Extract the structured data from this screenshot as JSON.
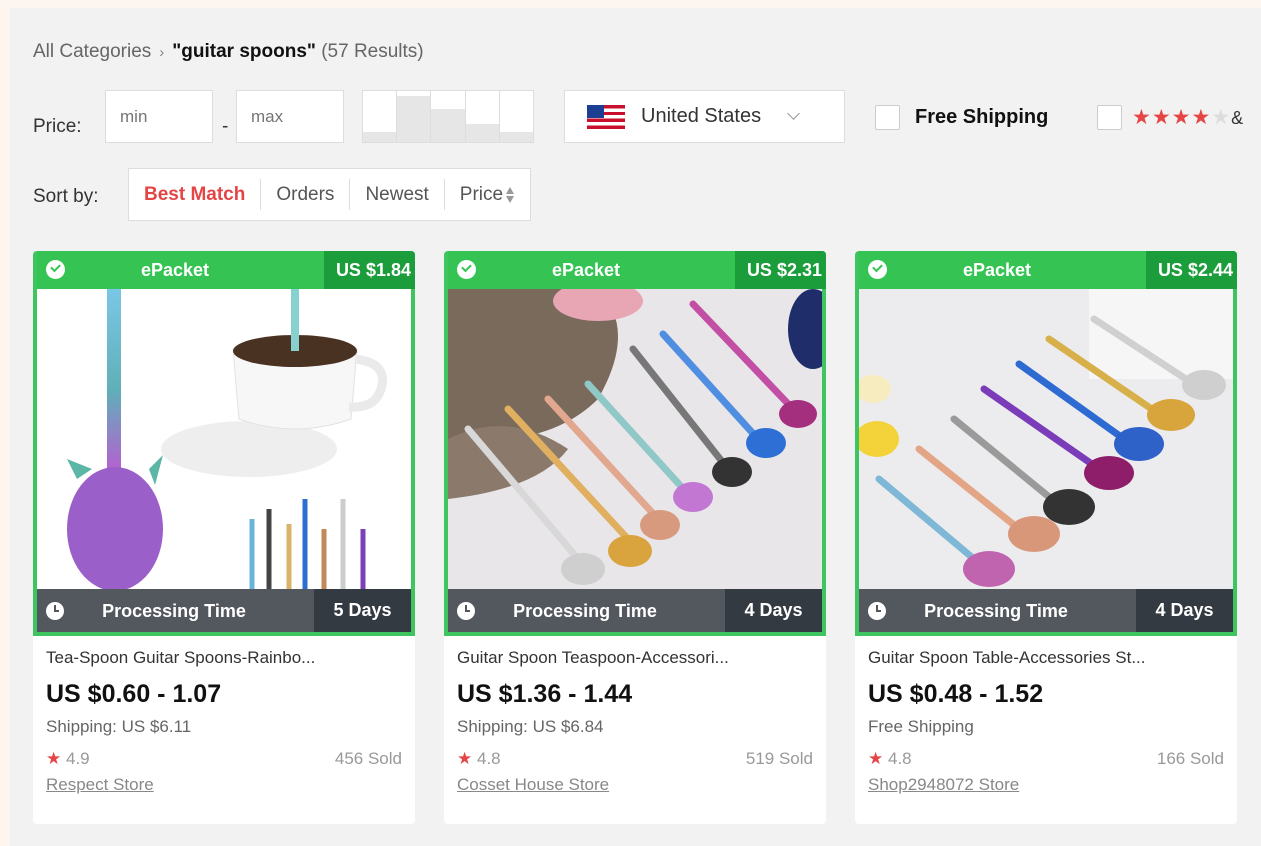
{
  "breadcrumb": {
    "root": "All Categories",
    "separator": "›",
    "query": "\"guitar spoons\"",
    "count": "(57 Results)"
  },
  "filters": {
    "price_label": "Price:",
    "min_placeholder": "min",
    "max_placeholder": "max",
    "dash": "-",
    "histogram_levels": [
      0.2,
      0.9,
      0.65,
      0.35,
      0.2
    ],
    "country": "United States",
    "free_shipping_label": "Free Shipping",
    "rating_stars": "★★★★",
    "rating_star_empty": "★",
    "rating_more": "&"
  },
  "sort": {
    "label": "Sort by:",
    "options": [
      "Best Match",
      "Orders",
      "Newest",
      "Price"
    ],
    "active": "Best Match"
  },
  "colors": {
    "accent": "#e64545",
    "epacket_green": "#35c453",
    "epacket_price_green": "#1c9d3c",
    "processing_gray": "#53575e",
    "processing_dark": "#343a42"
  },
  "products": [
    {
      "epacket": "ePacket",
      "epacket_price": "US $1.84",
      "processing": "Processing Time",
      "days": "5 Days",
      "title": "Tea-Spoon Guitar Spoons-Rainbo...",
      "price": "US $0.60 - 1.07",
      "shipping": "Shipping: US $6.11",
      "rating": "4.9",
      "sold": "456 Sold",
      "store": "Respect Store"
    },
    {
      "epacket": "ePacket",
      "epacket_price": "US $2.31",
      "processing": "Processing Time",
      "days": "4 Days",
      "title": "Guitar Spoon Teaspoon-Accessori...",
      "price": "US $1.36 - 1.44",
      "shipping": "Shipping: US $6.84",
      "rating": "4.8",
      "sold": "519 Sold",
      "store": "Cosset House Store"
    },
    {
      "epacket": "ePacket",
      "epacket_price": "US $2.44",
      "processing": "Processing Time",
      "days": "4 Days",
      "title": "Guitar Spoon Table-Accessories St...",
      "price": "US $0.48 - 1.52",
      "shipping": "Free Shipping",
      "rating": "4.8",
      "sold": "166 Sold",
      "store": "Shop2948072 Store"
    }
  ]
}
